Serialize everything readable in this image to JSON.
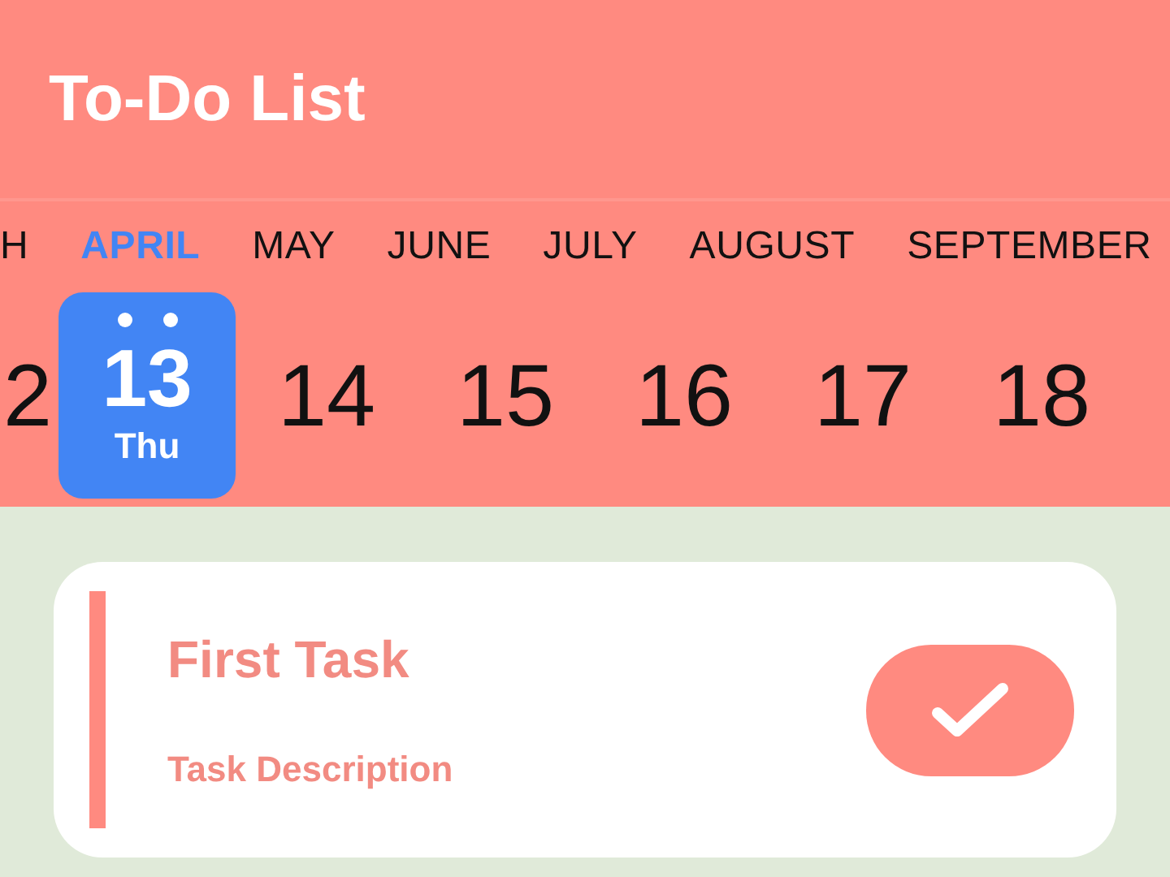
{
  "header": {
    "title": "To-Do List"
  },
  "months": [
    {
      "label": "H",
      "selected": false
    },
    {
      "label": "APRIL",
      "selected": true
    },
    {
      "label": "MAY",
      "selected": false
    },
    {
      "label": "JUNE",
      "selected": false
    },
    {
      "label": "JULY",
      "selected": false
    },
    {
      "label": "AUGUST",
      "selected": false
    },
    {
      "label": "SEPTEMBER",
      "selected": false
    }
  ],
  "dates": [
    {
      "day": "2",
      "selected": false
    },
    {
      "day": "13",
      "weekday": "Thu",
      "selected": true
    },
    {
      "day": "14",
      "selected": false
    },
    {
      "day": "15",
      "selected": false
    },
    {
      "day": "16",
      "selected": false
    },
    {
      "day": "17",
      "selected": false
    },
    {
      "day": "18",
      "selected": false
    }
  ],
  "tasks": [
    {
      "title": "First Task",
      "description": "Task Description"
    }
  ]
}
